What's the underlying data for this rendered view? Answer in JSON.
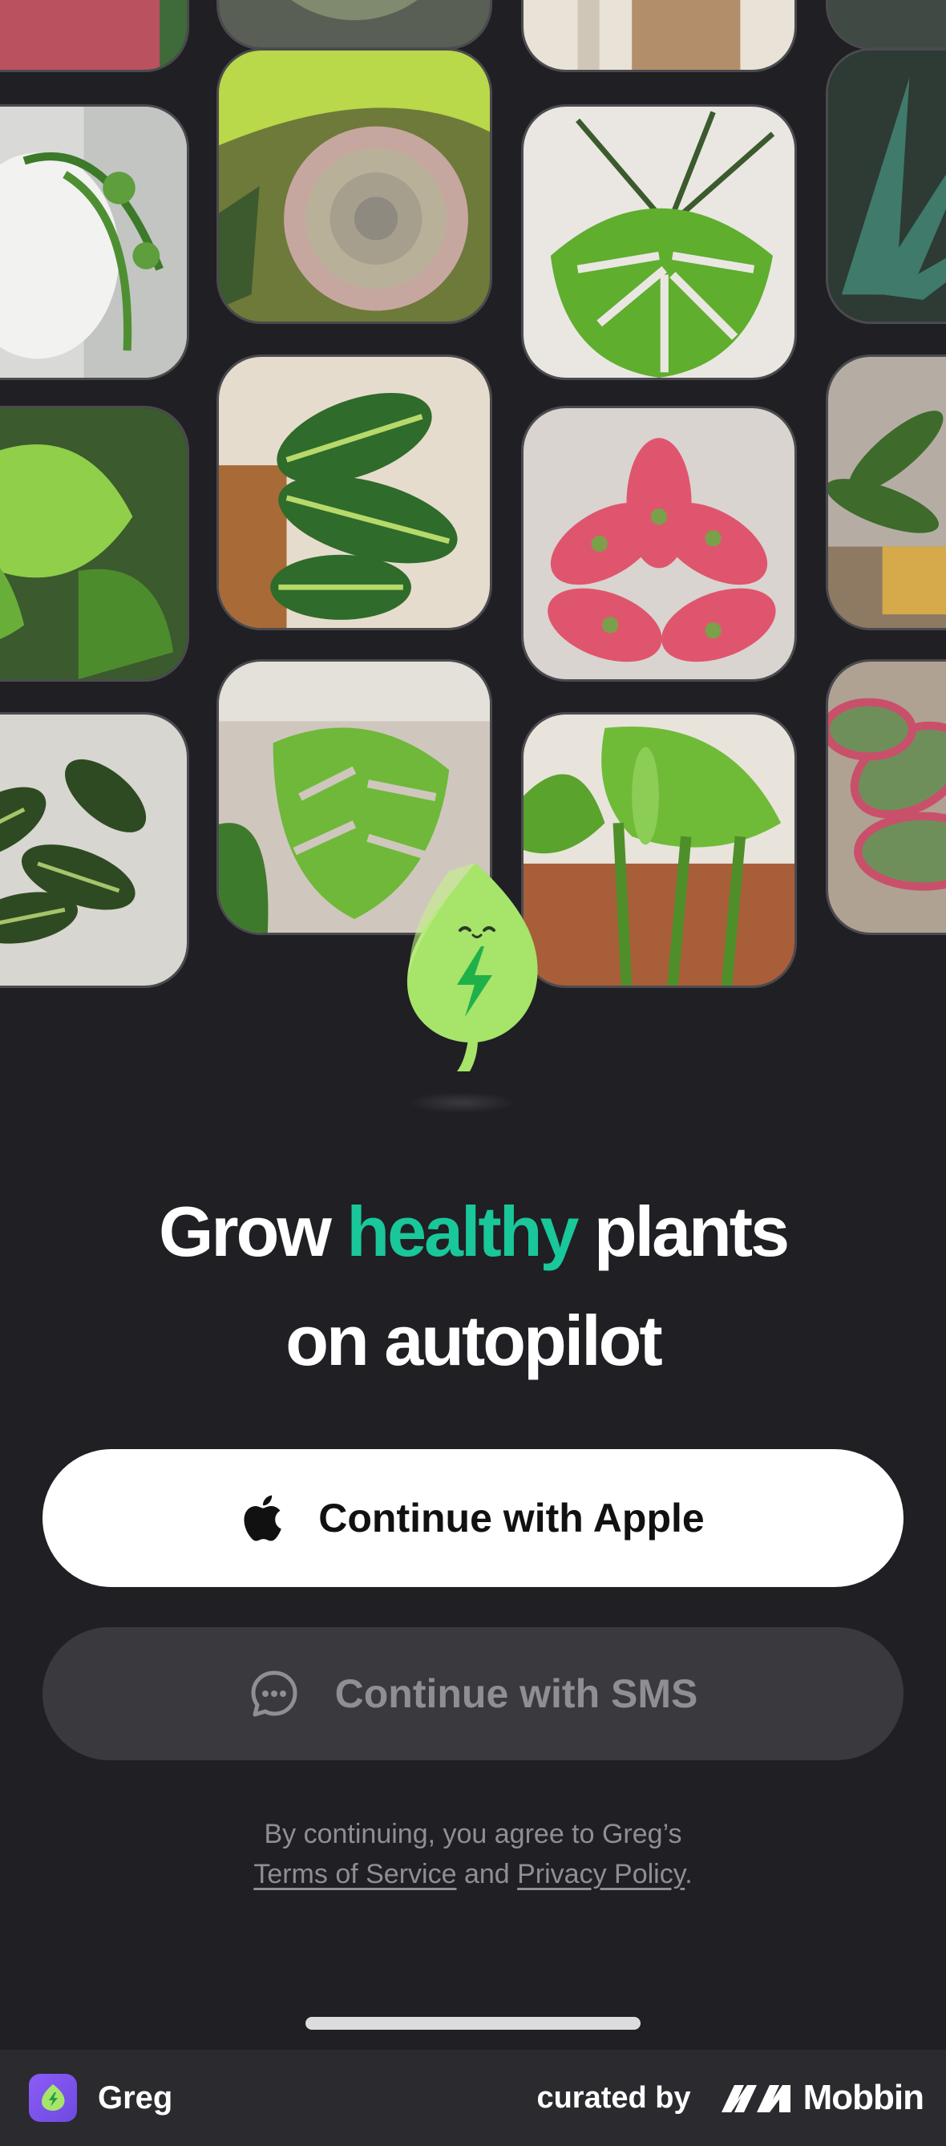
{
  "headline": {
    "part1": "Grow ",
    "accent": "healthy",
    "part2": " plants",
    "line2": "on autopilot"
  },
  "buttons": {
    "apple_label": "Continue with Apple",
    "apple_icon": "apple-icon",
    "sms_label": "Continue with SMS",
    "sms_icon": "chat-bubble-icon"
  },
  "legal": {
    "prefix": "By continuing, you agree to Greg’s",
    "terms": "Terms of Service",
    "and": " and ",
    "privacy": "Privacy Policy",
    "suffix": "."
  },
  "footer": {
    "app_name": "Greg",
    "curated_by": "curated by",
    "brand": "Mobbin"
  },
  "colors": {
    "background": "#201f24",
    "accent": "#19c79a",
    "button_primary": "#ffffff",
    "button_secondary": "#3a393e",
    "muted_text": "#8f8e95",
    "mascot_leaf": "#a6e46a"
  },
  "plant_photos": [
    "pink-edged succulent",
    "white face planter with trailing plant",
    "philodendron",
    "calathea",
    "echeveria succulent",
    "prayer plant",
    "monstera",
    "monstera",
    "pink aglaonema",
    "alocasia",
    "agave",
    "rattlesnake calathea",
    "red-edged succulent"
  ]
}
